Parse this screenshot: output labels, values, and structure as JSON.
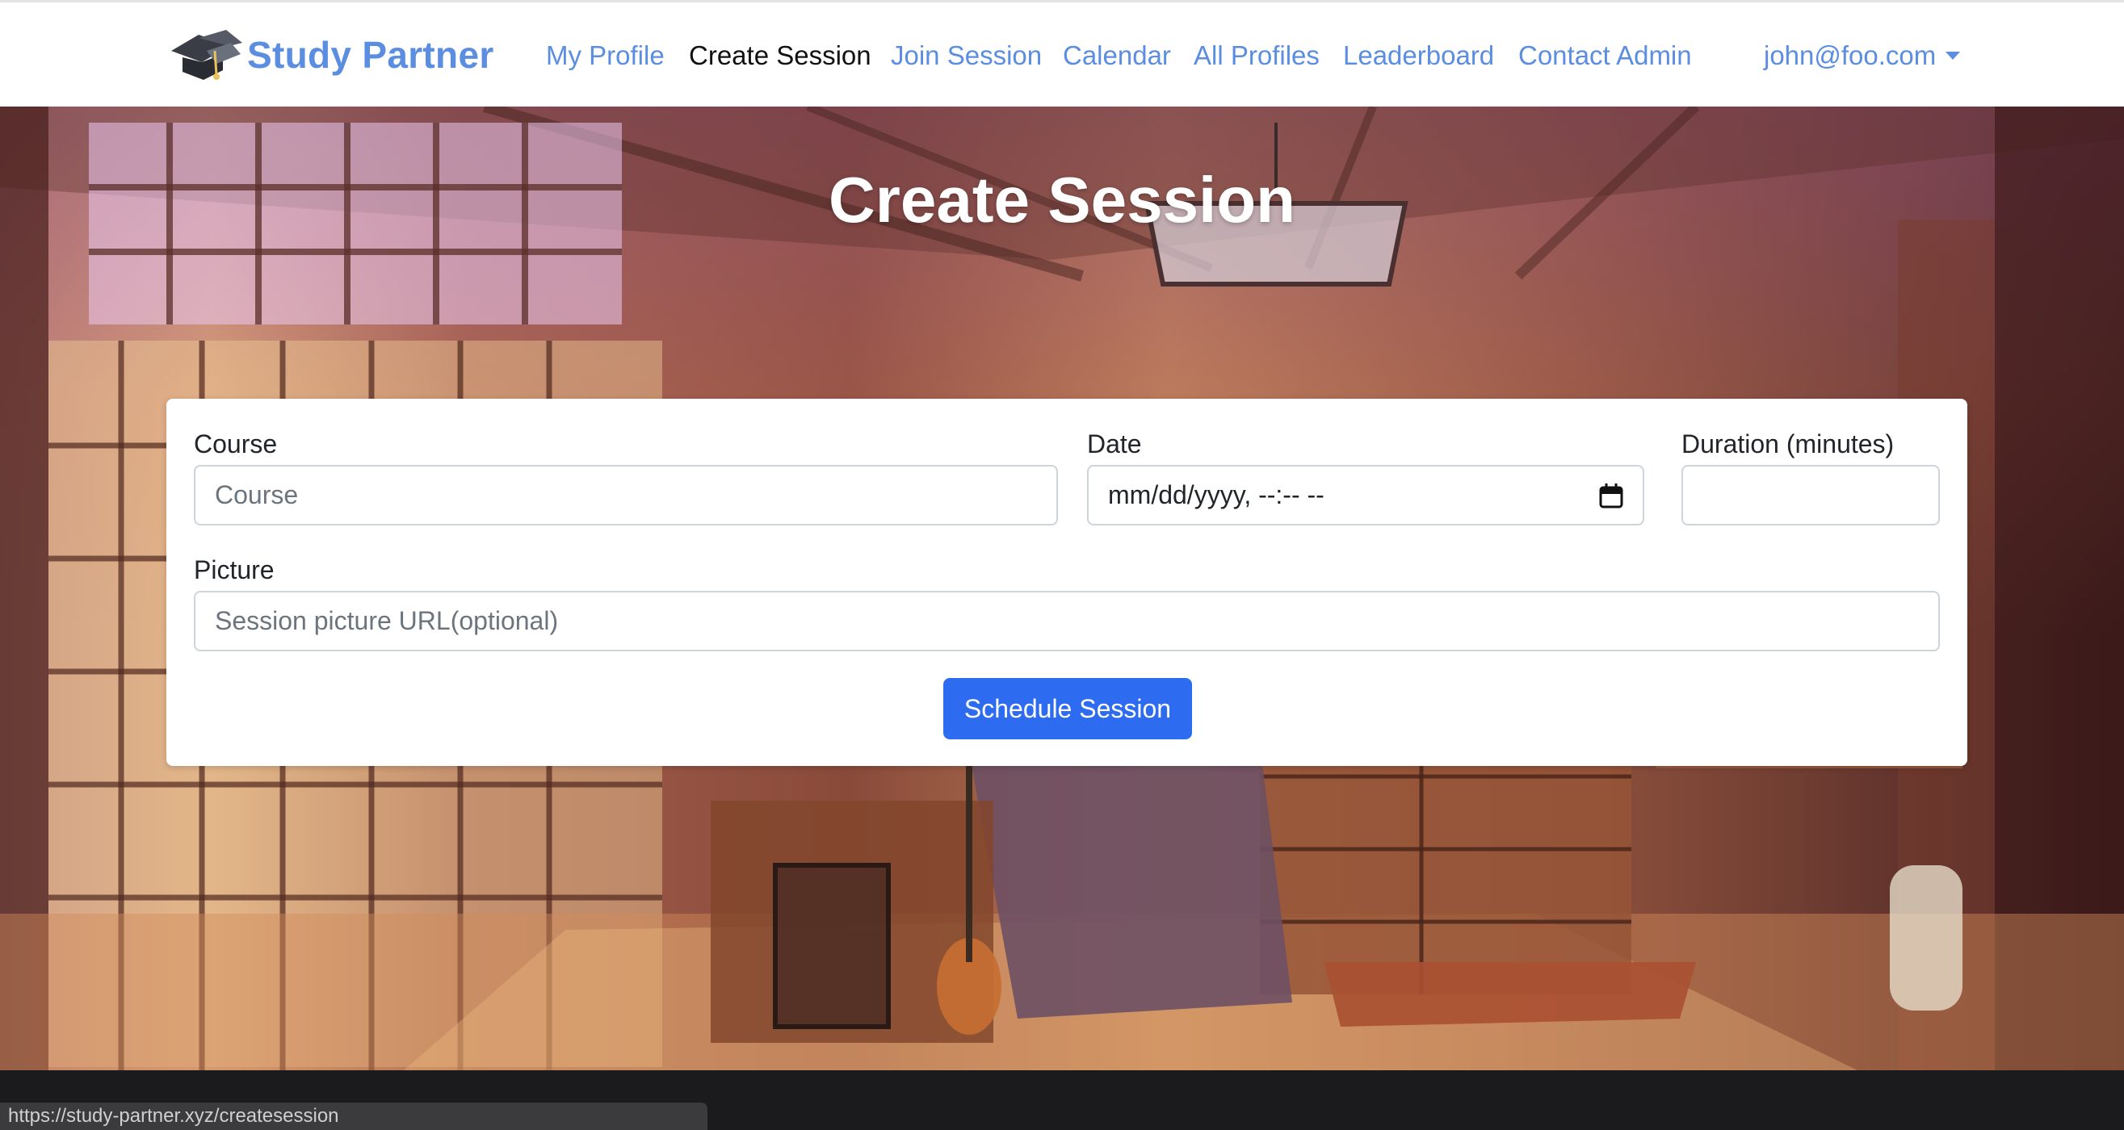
{
  "brand": {
    "name": "Study Partner",
    "logo_icon": "graduation-cap-icon"
  },
  "nav": {
    "my_profile": "My Profile",
    "create_session": "Create Session",
    "join_session": "Join Session",
    "calendar": "Calendar",
    "all_profiles": "All Profiles",
    "leaderboard": "Leaderboard",
    "contact_admin": "Contact Admin",
    "user": "john@foo.com",
    "active": "Create Session"
  },
  "page": {
    "title": "Create Session"
  },
  "form": {
    "course": {
      "label": "Course",
      "placeholder": "Course",
      "value": ""
    },
    "date": {
      "label": "Date",
      "display": "mm/dd/yyyy, --:-- --"
    },
    "duration": {
      "label": "Duration (minutes)",
      "value": ""
    },
    "picture": {
      "label": "Picture",
      "placeholder": "Session picture URL(optional)",
      "value": ""
    },
    "submit_label": "Schedule Session"
  },
  "status_bar": {
    "url": "https://study-partner.xyz/createsession"
  },
  "colors": {
    "brand": "#5b8de0",
    "button": "#2d6cf0",
    "active_nav": "#111111"
  }
}
